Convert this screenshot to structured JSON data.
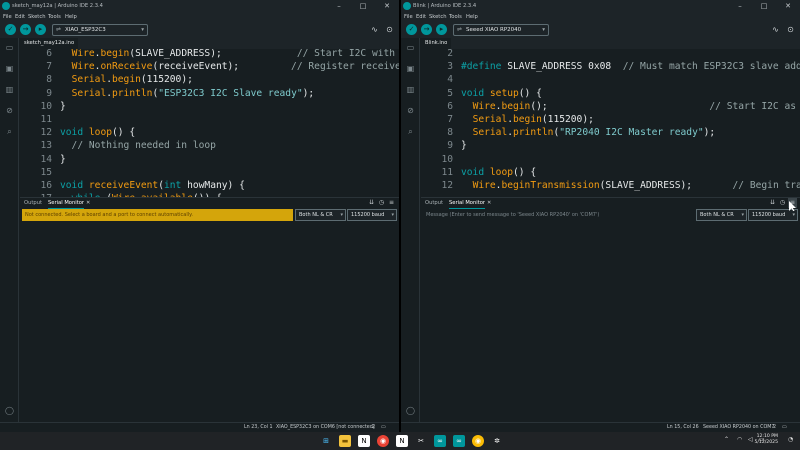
{
  "colors": {
    "keyword": "#0ca1a6",
    "function": "#f39c12",
    "string": "#7fcbcd",
    "comment": "#95a5a6",
    "text": "#e6e9ea",
    "accent": "#00979c",
    "warning_bg": "#d4a50b"
  },
  "left": {
    "title": "sketch_may12a | Arduino IDE 2.3.4",
    "menu": [
      "File",
      "Edit",
      "Sketch",
      "Tools",
      "Help"
    ],
    "board": "XIAO_ESP32C3",
    "file_tab": "sketch_may12a.ino",
    "code_lines": [
      {
        "n": "6",
        "segs": [
          {
            "t": "  ",
            "c": "text"
          },
          {
            "t": "Wire",
            "c": "function"
          },
          {
            "t": ".",
            "c": "text"
          },
          {
            "t": "begin",
            "c": "function"
          },
          {
            "t": "(SLAVE_ADDRESS);",
            "c": "text"
          },
          {
            "t": "             // Start I2C with add",
            "c": "comment"
          }
        ]
      },
      {
        "n": "7",
        "segs": [
          {
            "t": "  ",
            "c": "text"
          },
          {
            "t": "Wire",
            "c": "function"
          },
          {
            "t": ".",
            "c": "text"
          },
          {
            "t": "onReceive",
            "c": "function"
          },
          {
            "t": "(receiveEvent);",
            "c": "text"
          },
          {
            "t": "         // Register receive e",
            "c": "comment"
          }
        ]
      },
      {
        "n": "8",
        "segs": [
          {
            "t": "  ",
            "c": "text"
          },
          {
            "t": "Serial",
            "c": "function"
          },
          {
            "t": ".",
            "c": "text"
          },
          {
            "t": "begin",
            "c": "function"
          },
          {
            "t": "(115200);",
            "c": "text"
          }
        ]
      },
      {
        "n": "9",
        "segs": [
          {
            "t": "  ",
            "c": "text"
          },
          {
            "t": "Serial",
            "c": "function"
          },
          {
            "t": ".",
            "c": "text"
          },
          {
            "t": "println",
            "c": "function"
          },
          {
            "t": "(",
            "c": "text"
          },
          {
            "t": "\"ESP32C3 I2C Slave ready\"",
            "c": "string"
          },
          {
            "t": ");",
            "c": "text"
          }
        ]
      },
      {
        "n": "10",
        "segs": [
          {
            "t": "}",
            "c": "text"
          }
        ]
      },
      {
        "n": "11",
        "segs": [
          {
            "t": "",
            "c": "text"
          }
        ]
      },
      {
        "n": "12",
        "segs": [
          {
            "t": "void",
            "c": "keyword"
          },
          {
            "t": " ",
            "c": "text"
          },
          {
            "t": "loop",
            "c": "function"
          },
          {
            "t": "() {",
            "c": "text"
          }
        ]
      },
      {
        "n": "13",
        "segs": [
          {
            "t": "  // Nothing needed in loop",
            "c": "comment"
          }
        ]
      },
      {
        "n": "14",
        "segs": [
          {
            "t": "}",
            "c": "text"
          }
        ]
      },
      {
        "n": "15",
        "segs": [
          {
            "t": "",
            "c": "text"
          }
        ]
      },
      {
        "n": "16",
        "segs": [
          {
            "t": "void",
            "c": "keyword"
          },
          {
            "t": " ",
            "c": "text"
          },
          {
            "t": "receiveEvent",
            "c": "function"
          },
          {
            "t": "(",
            "c": "text"
          },
          {
            "t": "int",
            "c": "keyword"
          },
          {
            "t": " howMany) {",
            "c": "text"
          }
        ]
      },
      {
        "n": "17",
        "segs": [
          {
            "t": "  ",
            "c": "text"
          },
          {
            "t": "while",
            "c": "keyword"
          },
          {
            "t": " (",
            "c": "text"
          },
          {
            "t": "Wire",
            "c": "function"
          },
          {
            "t": ".",
            "c": "text"
          },
          {
            "t": "available",
            "c": "function"
          },
          {
            "t": "()) {",
            "c": "text"
          }
        ]
      }
    ],
    "panel_tabs": {
      "output": "Output",
      "serial": "Serial Monitor"
    },
    "message": "Not connected. Select a board and a port to connect automatically.",
    "line_ending": "Both NL & CR",
    "baud": "115200 baud",
    "status": {
      "position": "Ln 23, Col 1",
      "board": "XIAO_ESP32C3 on COM6 [not connected]",
      "notif": "2"
    }
  },
  "right": {
    "title": "Blink | Arduino IDE 2.3.4",
    "menu": [
      "File",
      "Edit",
      "Sketch",
      "Tools",
      "Help"
    ],
    "board": "Seeed XIAO RP2040",
    "file_tab": "Blink.ino",
    "code_lines": [
      {
        "n": "2",
        "segs": [
          {
            "t": "",
            "c": "text"
          }
        ]
      },
      {
        "n": "3",
        "segs": [
          {
            "t": "#define",
            "c": "keyword"
          },
          {
            "t": " SLAVE_ADDRESS 0x08  ",
            "c": "text"
          },
          {
            "t": "// Must match ESP32C3 slave address",
            "c": "comment"
          }
        ]
      },
      {
        "n": "4",
        "segs": [
          {
            "t": "",
            "c": "text"
          }
        ]
      },
      {
        "n": "5",
        "segs": [
          {
            "t": "void",
            "c": "keyword"
          },
          {
            "t": " ",
            "c": "text"
          },
          {
            "t": "setup",
            "c": "function"
          },
          {
            "t": "() {",
            "c": "text"
          }
        ]
      },
      {
        "n": "6",
        "segs": [
          {
            "t": "  ",
            "c": "text"
          },
          {
            "t": "Wire",
            "c": "function"
          },
          {
            "t": ".",
            "c": "text"
          },
          {
            "t": "begin",
            "c": "function"
          },
          {
            "t": "();",
            "c": "text"
          },
          {
            "t": "                            // Start I2C as mas",
            "c": "comment"
          }
        ]
      },
      {
        "n": "7",
        "segs": [
          {
            "t": "  ",
            "c": "text"
          },
          {
            "t": "Serial",
            "c": "function"
          },
          {
            "t": ".",
            "c": "text"
          },
          {
            "t": "begin",
            "c": "function"
          },
          {
            "t": "(115200);",
            "c": "text"
          }
        ]
      },
      {
        "n": "8",
        "segs": [
          {
            "t": "  ",
            "c": "text"
          },
          {
            "t": "Serial",
            "c": "function"
          },
          {
            "t": ".",
            "c": "text"
          },
          {
            "t": "println",
            "c": "function"
          },
          {
            "t": "(",
            "c": "text"
          },
          {
            "t": "\"RP2040 I2C Master ready\"",
            "c": "string"
          },
          {
            "t": ");",
            "c": "text"
          }
        ]
      },
      {
        "n": "9",
        "segs": [
          {
            "t": "}",
            "c": "text"
          }
        ]
      },
      {
        "n": "10",
        "segs": [
          {
            "t": "",
            "c": "text"
          }
        ]
      },
      {
        "n": "11",
        "segs": [
          {
            "t": "void",
            "c": "keyword"
          },
          {
            "t": " ",
            "c": "text"
          },
          {
            "t": "loop",
            "c": "function"
          },
          {
            "t": "() {",
            "c": "text"
          }
        ]
      },
      {
        "n": "12",
        "segs": [
          {
            "t": "  ",
            "c": "text"
          },
          {
            "t": "Wire",
            "c": "function"
          },
          {
            "t": ".",
            "c": "text"
          },
          {
            "t": "beginTransmission",
            "c": "function"
          },
          {
            "t": "(SLAVE_ADDRESS);",
            "c": "text"
          },
          {
            "t": "       // Begin transmissi",
            "c": "comment"
          }
        ]
      }
    ],
    "panel_tabs": {
      "output": "Output",
      "serial": "Serial Monitor"
    },
    "message_placeholder": "Message (Enter to send message to 'Seeed XIAO RP2040' on 'COM7')",
    "line_ending": "Both NL & CR",
    "baud": "115200 baud",
    "status": {
      "position": "Ln 15, Col 26",
      "board": "Seeed XIAO RP2040 on COM7",
      "notif": "2"
    }
  },
  "taskbar": {
    "apps": [
      "windows-start-icon",
      "file-explorer-icon",
      "notion-icon",
      "chrome-icon",
      "notion-icon",
      "capcut-icon",
      "arduino-icon",
      "arduino-icon",
      "chrome-icon",
      "chatgpt-icon"
    ],
    "time": "12:10 PM",
    "date": "5/12/2025"
  }
}
